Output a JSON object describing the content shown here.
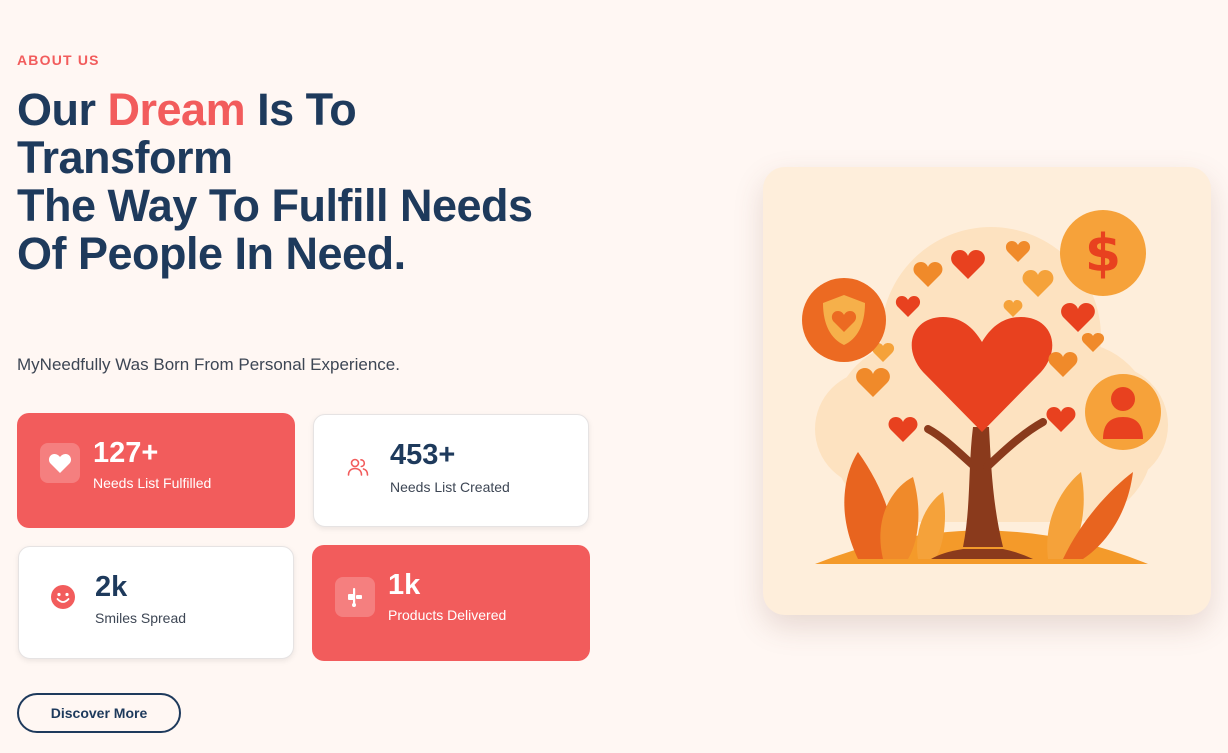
{
  "section": {
    "eyebrow": "ABOUT US",
    "headline": {
      "part1": "Our ",
      "accent": "Dream",
      "part2": " Is To Transform",
      "line2": "The Way To Fulfill Needs",
      "line3": "Of People In Need."
    },
    "subtitle": "MyNeedfully Was Born From Personal Experience."
  },
  "stats": [
    {
      "value": "127+",
      "label": "Needs List Fulfilled",
      "icon": "heart-icon",
      "style": "accent"
    },
    {
      "value": "453+",
      "label": "Needs List Created",
      "icon": "users-icon",
      "style": "plain"
    },
    {
      "value": "2k",
      "label": "Smiles Spread",
      "icon": "smile-icon",
      "style": "plain"
    },
    {
      "value": "1k",
      "label": "Products Delivered",
      "icon": "dolly-icon",
      "style": "accent"
    }
  ],
  "cta": {
    "label": "Discover More"
  },
  "colors": {
    "accent": "#f25c5c",
    "navy": "#1e3a5c",
    "background": "#fff7f3"
  },
  "illustration": {
    "description_icon": "heart-tree-illustration"
  }
}
